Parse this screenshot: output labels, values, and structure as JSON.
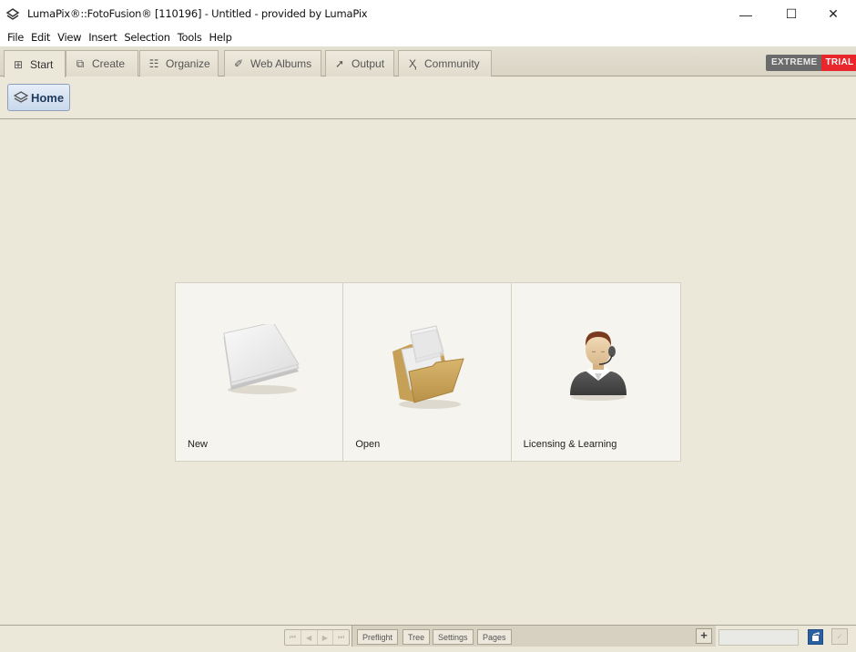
{
  "window": {
    "title": "LumaPix®::FotoFusion® [110196] - Untitled - provided by LumaPix",
    "app_icon": "lumapix-logo-icon",
    "controls": {
      "minimize": "—",
      "maximize": "☐",
      "close": "✕"
    }
  },
  "menu": {
    "items": [
      "File",
      "Edit",
      "View",
      "Insert",
      "Selection",
      "Tools",
      "Help"
    ]
  },
  "tabs": [
    {
      "label": "Start",
      "icon": "grid-icon",
      "glyph": "⊞",
      "active": true
    },
    {
      "label": "Create",
      "icon": "create-icon",
      "glyph": "⧉",
      "active": false
    },
    {
      "label": "Organize",
      "icon": "list-icon",
      "glyph": "☷",
      "active": false
    },
    {
      "label": "Web Albums",
      "icon": "web-albums-icon",
      "glyph": "✐",
      "active": false
    },
    {
      "label": "Output",
      "icon": "output-arrow-icon",
      "glyph": "➚",
      "active": false
    },
    {
      "label": "Community",
      "icon": "community-icon",
      "glyph": "Ҳ",
      "active": false
    }
  ],
  "edition": {
    "name": "EXTREME",
    "status": "TRIAL",
    "status_color": "#e8262b"
  },
  "toolbar": {
    "home_label": "Home"
  },
  "cards": [
    {
      "label": "New",
      "icon": "new-document-icon"
    },
    {
      "label": "Open",
      "icon": "open-folder-icon"
    },
    {
      "label": "Licensing & Learning",
      "icon": "support-agent-icon"
    }
  ],
  "bottom": {
    "nav": {
      "first": "⏮",
      "prev": "◀",
      "next": "▶",
      "last": "⏭"
    },
    "panel_tabs": [
      "Preflight",
      "Tree",
      "Settings",
      "Pages"
    ],
    "add_label": "+",
    "search_value": "",
    "search_placeholder": ""
  },
  "colors": {
    "background": "#ebe7d9",
    "home_button": "#c9d8ec",
    "blue_button": "#2b5f9e"
  }
}
